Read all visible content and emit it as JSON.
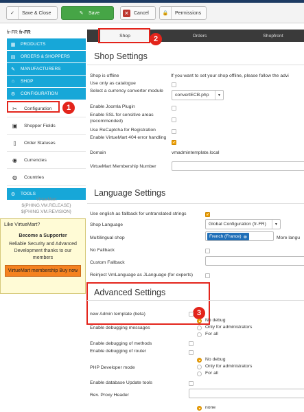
{
  "toolbar": {
    "save_close": "Save & Close",
    "save": "Save",
    "cancel": "Cancel",
    "permissions": "Permissions"
  },
  "sidebar": {
    "lang_prefix": "fr-FR",
    "lang_bold": "fr-FR",
    "items": [
      {
        "label": "PRODUCTS",
        "icon": "products-icon"
      },
      {
        "label": "ORDERS & SHOPPERS",
        "icon": "orders-icon"
      },
      {
        "label": "MANUFACTURERS",
        "icon": "manufacturers-icon"
      },
      {
        "label": "SHOP",
        "icon": "shop-icon"
      },
      {
        "label": "CONFIGURATION",
        "icon": "configuration-icon"
      }
    ],
    "sub_items": [
      {
        "label": "Configuration",
        "icon": "wrench-icon"
      },
      {
        "label": "Shopper Fields",
        "icon": "form-icon"
      },
      {
        "label": "Order Statuses",
        "icon": "document-icon"
      },
      {
        "label": "Currencies",
        "icon": "coins-icon"
      },
      {
        "label": "Countries",
        "icon": "globe-icon"
      }
    ],
    "tools": "TOOLS",
    "version_line1": "VirtueMart",
    "version_line2": "${PHING.VM.RELEASE}",
    "version_line3": "${PHING.VM.REVISION}"
  },
  "support": {
    "like": "Like VirtueMart?",
    "become": "Become a Supporter",
    "desc": "Reliable Security and Advanced Development thanks to our members",
    "button": "VirtueMart membership Buy now"
  },
  "callouts": {
    "one": "1",
    "two": "2",
    "three": "3"
  },
  "tabs": [
    {
      "label": "Shop"
    },
    {
      "label": "Orders"
    },
    {
      "label": "Shopfront"
    }
  ],
  "shop_settings": {
    "title": "Shop Settings",
    "offline_label": "Shop is offline",
    "offline_note": "If you want to set your shop offline, please follow the advi",
    "catalogue_label": "Use only as catalogue",
    "currency_label": "Select a currency converter module",
    "currency_value": "convertECB.php",
    "joomla_plugin_label": "Enable Joomla Plugin",
    "ssl_label": "Enable SSL for sensitive areas (recommended)",
    "recaptcha_label": "Use ReCaptcha for Registration",
    "error404_label": "Enable VirtueMart 404 error handling",
    "domain_label": "Domain",
    "domain_value": "vmadmintemplate.local",
    "membership_number_label": "VirtueMart Membership Number"
  },
  "language_settings": {
    "title": "Language Settings",
    "fallback_english_label": "Use english as fallback for untranslated strings",
    "shop_language_label": "Shop Language",
    "shop_language_value": "Global Configuration (fr-FR)",
    "multilingual_label": "Multilingual shop",
    "multilingual_chip": "French (France)",
    "more_languages": "More langu",
    "no_fallback_label": "No Fallback",
    "custom_fallback_label": "Custom Fallback",
    "reinject_label": "Reinject VmLanguage as JLanguage (for experts)"
  },
  "advanced_settings": {
    "title": "Advanced Settings",
    "new_admin_label": "new Admin template (beta)",
    "debug_label": "Enable debugging messages",
    "debug_options": [
      "No debug",
      "Only for administrators",
      "For all"
    ],
    "debug_methods_label": "Enable debugging of methods",
    "debug_router_label": "Enable debugging of router",
    "php_dev_label": "PHP Developer mode",
    "php_dev_options": [
      "No debug",
      "Only for administrators",
      "For all"
    ],
    "db_update_label": "Enable database Update tools",
    "proxy_label": "Rev. Proxy Header",
    "last_option": "none"
  },
  "colors": {
    "accent_blue": "#17a7d8",
    "highlight_red": "#e3241b",
    "save_green": "#46a546",
    "membership_orange": "#f58220",
    "toggle_orange": "#f0a30a"
  }
}
